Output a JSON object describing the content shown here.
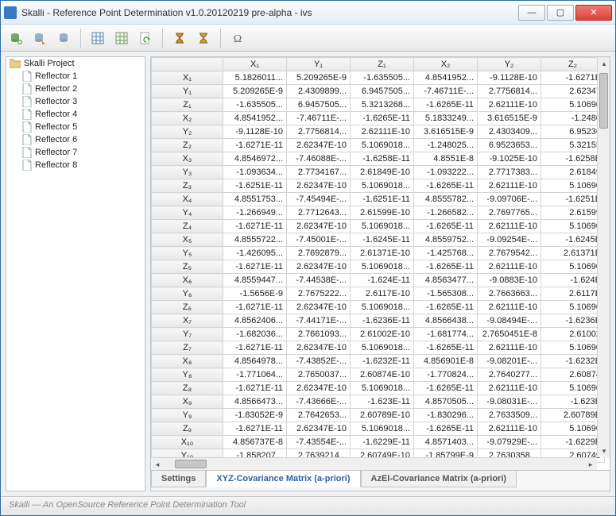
{
  "window": {
    "title": "Skalli - Reference Point Determination v1.0.20120219 pre-alpha - ivs"
  },
  "tree": {
    "root": "Skalli Project",
    "items": [
      {
        "label": "Reflector 1"
      },
      {
        "label": "Reflector 2"
      },
      {
        "label": "Reflector 3"
      },
      {
        "label": "Reflector 4"
      },
      {
        "label": "Reflector 5"
      },
      {
        "label": "Reflector 6"
      },
      {
        "label": "Reflector 7"
      },
      {
        "label": "Reflector 8"
      }
    ]
  },
  "matrix": {
    "col_headers": [
      "X₁",
      "Y₁",
      "Z₁",
      "X₂",
      "Y₂",
      "Z₂"
    ],
    "rows": [
      {
        "h": "X₁",
        "c": [
          "5.1826011...",
          "5.209265E-9",
          "-1.635505...",
          "4.8541952...",
          "-9.1128E-10",
          "-1.6271E"
        ]
      },
      {
        "h": "Y₁",
        "c": [
          "5.209265E-9",
          "2.4309899...",
          "6.9457505...",
          "-7.46711E-...",
          "2.7756814...",
          "2.62347"
        ]
      },
      {
        "h": "Z₁",
        "c": [
          "-1.635505...",
          "6.9457505...",
          "5.3213268...",
          "-1.6265E-11",
          "2.62111E-10",
          "5.10690"
        ]
      },
      {
        "h": "X₂",
        "c": [
          "4.8541952...",
          "-7.46711E-...",
          "-1.6265E-11",
          "5.1833249...",
          "3.616515E-9",
          "-1.2480"
        ]
      },
      {
        "h": "Y₂",
        "c": [
          "-9.1128E-10",
          "2.7756814...",
          "2.62111E-10",
          "3.616515E-9",
          "2.4303409...",
          "6.95236"
        ]
      },
      {
        "h": "Z₂",
        "c": [
          "-1.6271E-11",
          "2.62347E-10",
          "5.1069018...",
          "-1.248025...",
          "6.9523653...",
          "5.32155"
        ]
      },
      {
        "h": "X₃",
        "c": [
          "4.8546972...",
          "-7.46088E-...",
          "-1.6258E-11",
          "4.8551E-8",
          "-9.1025E-10",
          "-1.6258E"
        ]
      },
      {
        "h": "Y₃",
        "c": [
          "-1.093634...",
          "2.7734167...",
          "2.61849E-10",
          "-1.093222...",
          "2.7717383...",
          "2.61849"
        ]
      },
      {
        "h": "Z₃",
        "c": [
          "-1.6251E-11",
          "2.62347E-10",
          "5.1069018...",
          "-1.6265E-11",
          "2.62111E-10",
          "5.10690"
        ]
      },
      {
        "h": "X₄",
        "c": [
          "4.8551753...",
          "-7.45494E-...",
          "-1.6251E-11",
          "4.8555782...",
          "-9.09706E-...",
          "-1.6251E"
        ]
      },
      {
        "h": "Y₄",
        "c": [
          "-1.266949...",
          "2.7712643...",
          "2.61599E-10",
          "-1.266582...",
          "2.7697765...",
          "2.61599"
        ]
      },
      {
        "h": "Z₄",
        "c": [
          "-1.6271E-11",
          "2.62347E-10",
          "5.1069018...",
          "-1.6265E-11",
          "2.62111E-10",
          "5.10690"
        ]
      },
      {
        "h": "X₅",
        "c": [
          "4.8555722...",
          "-7.45001E-...",
          "-1.6245E-11",
          "4.8559752...",
          "-9.09254E-...",
          "-1.6245E"
        ]
      },
      {
        "h": "Y₅",
        "c": [
          "-1.426095...",
          "2.7692879...",
          "2.61371E-10",
          "-1.425768...",
          "2.7679542...",
          "2.61371E"
        ]
      },
      {
        "h": "Z₅",
        "c": [
          "-1.6271E-11",
          "2.62347E-10",
          "5.1069018...",
          "-1.6265E-11",
          "2.62111E-10",
          "5.10690"
        ]
      },
      {
        "h": "X₆",
        "c": [
          "4.8559447...",
          "-7.44538E-...",
          "-1.624E-11",
          "4.8563477...",
          "-9.0883E-10",
          "-1.624E"
        ]
      },
      {
        "h": "Y₆",
        "c": [
          "-1.5656E-9",
          "2.7675222...",
          "2.6117E-10",
          "-1.565308...",
          "2.7663663...",
          "2.6117E"
        ]
      },
      {
        "h": "Z₆",
        "c": [
          "-1.6271E-11",
          "2.62347E-10",
          "5.1069018...",
          "-1.6265E-11",
          "2.62111E-10",
          "5.10690"
        ]
      },
      {
        "h": "X₇",
        "c": [
          "4.8562406...",
          "-7.44171E-...",
          "-1.6236E-11",
          "4.8566438...",
          "-9.08494E-...",
          "-1.6236E"
        ]
      },
      {
        "h": "Y₇",
        "c": [
          "-1.682036...",
          "2.7661093...",
          "2.61002E-10",
          "-1.681774...",
          "2.7650451E-8",
          "2.61002"
        ]
      },
      {
        "h": "Z₇",
        "c": [
          "-1.6271E-11",
          "2.62347E-10",
          "5.1069018...",
          "-1.6265E-11",
          "2.62111E-10",
          "5.10690"
        ]
      },
      {
        "h": "X₈",
        "c": [
          "4.8564978...",
          "-7.43852E-...",
          "-1.6232E-11",
          "4.856901E-8",
          "-9.08201E-...",
          "-1.6232E"
        ]
      },
      {
        "h": "Y₈",
        "c": [
          "-1.771064...",
          "2.7650037...",
          "2.60874E-10",
          "-1.770824...",
          "2.7640277...",
          "2.60874"
        ]
      },
      {
        "h": "Z₈",
        "c": [
          "-1.6271E-11",
          "2.62347E-10",
          "5.1069018...",
          "-1.6265E-11",
          "2.62111E-10",
          "5.10690"
        ]
      },
      {
        "h": "X₉",
        "c": [
          "4.8566473...",
          "-7.43666E-...",
          "-1.623E-11",
          "4.8570505...",
          "-9.08031E-...",
          "-1.623E"
        ]
      },
      {
        "h": "Y₉",
        "c": [
          "-1.83052E-9",
          "2.7642653...",
          "2.60789E-10",
          "-1.830296...",
          "2.7633509...",
          "2.60789E"
        ]
      },
      {
        "h": "Z₉",
        "c": [
          "-1.6271E-11",
          "2.62347E-10",
          "5.1069018...",
          "-1.6265E-11",
          "2.62111E-10",
          "5.10690"
        ]
      },
      {
        "h": "X₁₀",
        "c": [
          "4.856737E-8",
          "-7.43554E-...",
          "-1.6229E-11",
          "4.8571403...",
          "-9.07929E-...",
          "-1.6229E"
        ]
      },
      {
        "h": "Y₁₀",
        "c": [
          "-1.858207...",
          "2.7639214...",
          "2.60749E-10",
          "-1.85799E-9",
          "2.7630358...",
          "2.60749"
        ]
      }
    ]
  },
  "tabs": {
    "settings": "Settings",
    "xyz": "XYZ-Covariance Matrix (a-priori)",
    "azel": "AzEl-Covariance Matrix (a-priori)"
  },
  "status": {
    "prefix": "Skalli — An ",
    "mid": "OpenSource",
    "suffix": " Reference Point Determination Tool"
  }
}
